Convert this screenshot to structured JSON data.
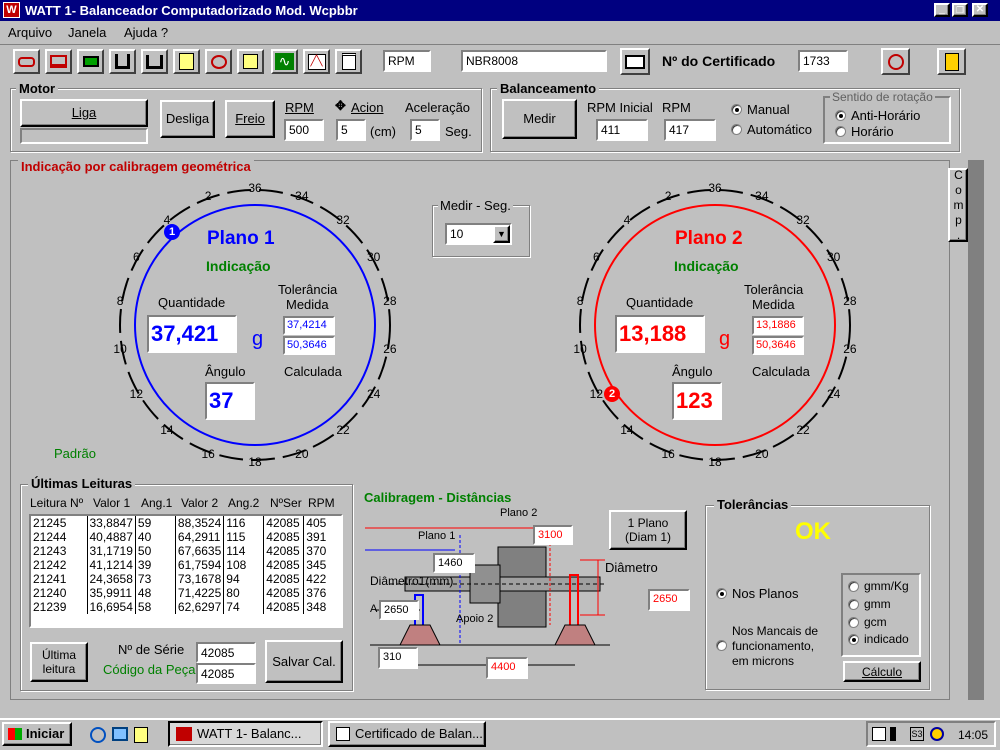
{
  "window": {
    "title": "WATT 1- Balanceador Computadorizado  Mod. Wcpbbr",
    "icon_text": "W"
  },
  "menu": [
    {
      "label": "Arquivo"
    },
    {
      "label": "Janela"
    },
    {
      "label": "Ajuda ?"
    }
  ],
  "toolbar": {
    "icons": [
      "rotor-icon",
      "machine-icon",
      "chip-icon",
      "clamp-icon",
      "balance-icon",
      "notepad-icon",
      "coil-icon",
      "list-icon",
      "sine-wave-icon",
      "chart-icon",
      "document-icon"
    ],
    "rpm_field": "RPM",
    "norm_field": "NBR8008",
    "certificate_label": "Nº do Certificado",
    "certificate_number": "1733"
  },
  "motor": {
    "title": "Motor",
    "liga": "Liga",
    "desliga": "Desliga",
    "freio": "Freio",
    "rpm_label": "RPM",
    "rpm_value": "500",
    "acion_label": "Acion",
    "acion_value": "5",
    "acion_unit": "(cm)",
    "aceleracao_label": "Aceleração",
    "aceleracao_value": "5",
    "aceleracao_unit": "Seg."
  },
  "balanceamento": {
    "title": "Balanceamento",
    "medir": "Medir",
    "rpm_inicial_label": "RPM Inicial",
    "rpm_inicial_value": "411",
    "rpm_label": "RPM",
    "rpm_value": "417",
    "manual": "Manual",
    "automatico": "Automático",
    "sentido_title": "Sentido de rotação",
    "anti_horario": "Anti-Horário",
    "horario": "Horário"
  },
  "indicacao": {
    "title": "Indicação por calibragem geométrica",
    "comp": "Comp.",
    "padrao": "Padrão",
    "medir_seg_label": "Medir - Seg.",
    "medir_seg_value": "10",
    "dial_numbers": [
      "36",
      "34",
      "32",
      "30",
      "28",
      "26",
      "24",
      "22",
      "20",
      "18",
      "16",
      "14",
      "12",
      "10",
      "8",
      "6",
      "4",
      "2"
    ]
  },
  "plano1": {
    "title": "Plano 1",
    "subtitle": "Indicação",
    "quantidade_label": "Quantidade",
    "quantidade": "37,421",
    "unit": "g",
    "tolerancia_label": "Tolerância",
    "medida_label": "Medida",
    "tol_medida": "37,4214",
    "tol_calculada": "50,3646",
    "calculada_label": "Calculada",
    "angulo_label": "Ângulo",
    "angulo": "37",
    "marker": "1",
    "color": "#0000ff"
  },
  "plano2": {
    "title": "Plano 2",
    "subtitle": "Indicação",
    "quantidade_label": "Quantidade",
    "quantidade": "13,188",
    "unit": "g",
    "tolerancia_label": "Tolerância",
    "medida_label": "Medida",
    "tol_medida": "13,1886",
    "tol_calculada": "50,3646",
    "calculada_label": "Calculada",
    "angulo_label": "Ângulo",
    "angulo": "123",
    "marker": "2",
    "color": "#ff0000"
  },
  "leituras": {
    "title": "Últimas Leituras",
    "headers": [
      "Leitura Nº",
      "Valor 1",
      "Ang.1",
      "Valor 2",
      "Ang.2",
      "NºSer",
      "RPM"
    ],
    "rows": [
      [
        "21245",
        "33,8847",
        "59",
        "88,3524",
        "116",
        "42085",
        "405"
      ],
      [
        "21244",
        "40,4887",
        "40",
        "64,2911",
        "115",
        "42085",
        "391"
      ],
      [
        "21243",
        "31,1719",
        "50",
        "67,6635",
        "114",
        "42085",
        "370"
      ],
      [
        "21242",
        "41,1214",
        "39",
        "61,7594",
        "108",
        "42085",
        "345"
      ],
      [
        "21241",
        "24,3658",
        "73",
        "73,1678",
        "94",
        "42085",
        "422"
      ],
      [
        "21240",
        "35,9911",
        "48",
        "71,4225",
        "80",
        "42085",
        "376"
      ],
      [
        "21239",
        "16,6954",
        "58",
        "62,6297",
        "74",
        "42085",
        "348"
      ]
    ],
    "ultima_leitura": "Última leitura",
    "n_serie_label": "Nº de Série",
    "n_serie": "42085",
    "codigo_label": "Código da Peça",
    "codigo": "42085",
    "salvar": "Salvar Cal."
  },
  "calibragem": {
    "title": "Calibragem - Distâncias",
    "plano2_label": "Plano 2",
    "plano1_label": "Plano 1",
    "v3100": "3100",
    "v1460": "1460",
    "v2650a": "2650",
    "v2650b": "2650",
    "v310": "310",
    "v4400": "4400",
    "diametro_mm": "Diâmetro1(mm)",
    "diametro": "Diâmetro",
    "apoio2": "Apoio 2",
    "a_label": "A",
    "plano_diam": "1 Plano (Diam 1)"
  },
  "tolerancias": {
    "title": "Tolerâncias",
    "status": "OK",
    "status_color": "#ffff00",
    "nos_planos": "Nos Planos",
    "nos_mancais": "Nos Mancais de funcionamento, em microns",
    "units": [
      "gmm/Kg",
      "gmm",
      "gcm",
      "indicado"
    ],
    "calculo": "Cálculo"
  },
  "taskbar": {
    "start": "Iniciar",
    "task1": "WATT 1- Balanc...",
    "task2": "Certificado de Balan...",
    "clock": "14:05"
  }
}
